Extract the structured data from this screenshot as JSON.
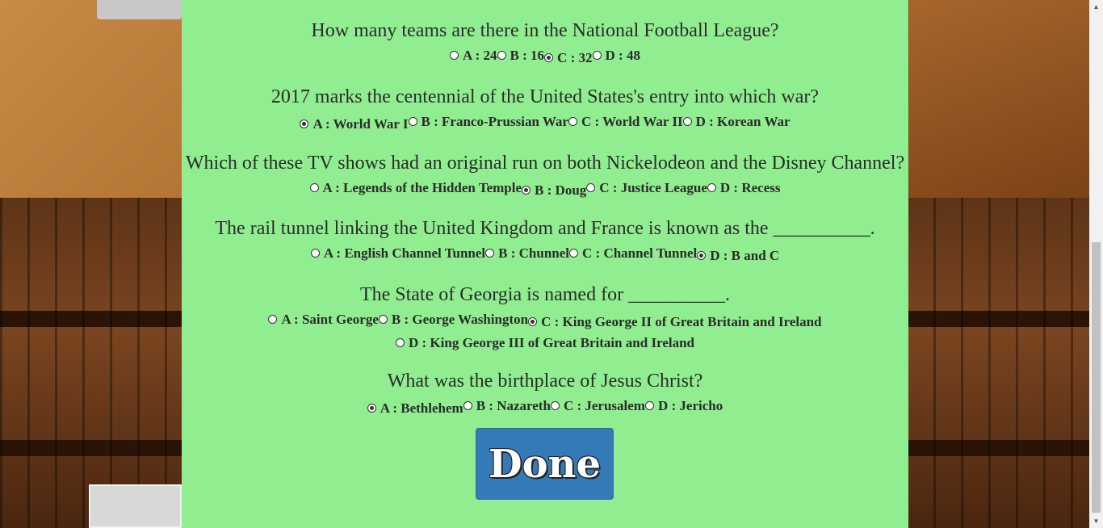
{
  "questions": [
    {
      "text": "How many teams are there in the National Football League?",
      "options": [
        {
          "label": "A : 24",
          "checked": false
        },
        {
          "label": "B : 16",
          "checked": false
        },
        {
          "label": "C : 32",
          "checked": true
        },
        {
          "label": "D : 48",
          "checked": false
        }
      ]
    },
    {
      "text": "2017 marks the centennial of the United States's entry into which war?",
      "options": [
        {
          "label": "A : World War I",
          "checked": true
        },
        {
          "label": "B : Franco-Prussian War",
          "checked": false
        },
        {
          "label": "C : World War II",
          "checked": false
        },
        {
          "label": "D : Korean War",
          "checked": false
        }
      ]
    },
    {
      "text": "Which of these TV shows had an original run on both Nickelodeon and the Disney Channel?",
      "options": [
        {
          "label": "A : Legends of the Hidden Temple",
          "checked": false
        },
        {
          "label": "B : Doug",
          "checked": true
        },
        {
          "label": "C : Justice League",
          "checked": false
        },
        {
          "label": "D : Recess",
          "checked": false
        }
      ]
    },
    {
      "text": "The rail tunnel linking the United Kingdom and France is known as the __________.",
      "options": [
        {
          "label": "A : English Channel Tunnel",
          "checked": false
        },
        {
          "label": "B : Chunnel",
          "checked": false
        },
        {
          "label": "C : Channel Tunnel",
          "checked": false
        },
        {
          "label": "D : B and C",
          "checked": true
        }
      ]
    },
    {
      "text": "The State of Georgia is named for __________.",
      "options": [
        {
          "label": "A : Saint George",
          "checked": false
        },
        {
          "label": "B : George Washington",
          "checked": false
        },
        {
          "label": "C : King George II of Great Britain and Ireland",
          "checked": true
        },
        {
          "label": "D : King George III of Great Britain and Ireland",
          "checked": false
        }
      ]
    },
    {
      "text": "What was the birthplace of Jesus Christ?",
      "options": [
        {
          "label": "A : Bethlehem",
          "checked": true
        },
        {
          "label": "B : Nazareth",
          "checked": false
        },
        {
          "label": "C : Jerusalem",
          "checked": false
        },
        {
          "label": "D : Jericho",
          "checked": false
        }
      ]
    }
  ],
  "done_button": {
    "label": "Done",
    "color": "#337ab7"
  },
  "panel_color": "#90ee90"
}
